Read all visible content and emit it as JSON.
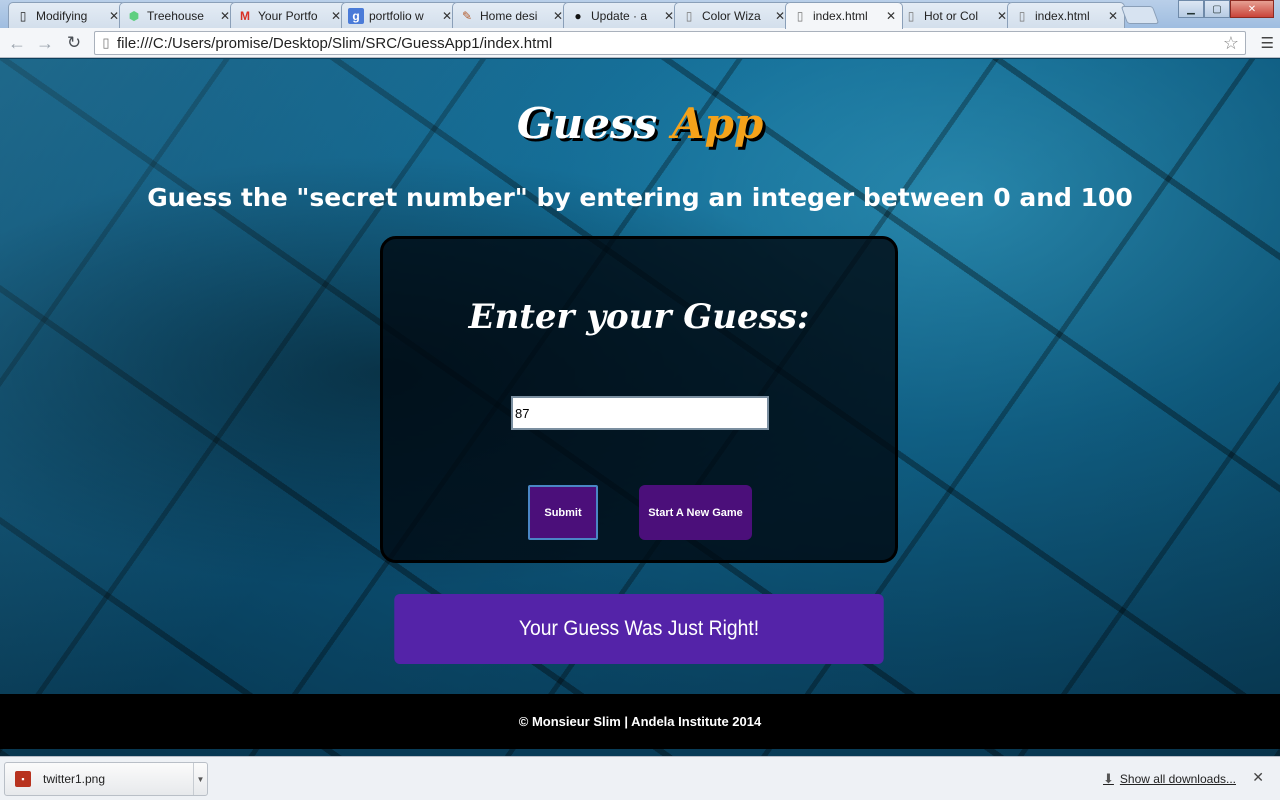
{
  "browser": {
    "tabs": [
      {
        "label": "Modifying",
        "icon": "doc-g-icon",
        "active": false
      },
      {
        "label": "Treehouse",
        "icon": "treehouse-icon",
        "active": false
      },
      {
        "label": "Your Portfo",
        "icon": "gmail-icon",
        "active": false
      },
      {
        "label": "portfolio w",
        "icon": "google-icon",
        "active": false
      },
      {
        "label": "Home desi",
        "icon": "pen-icon",
        "active": false
      },
      {
        "label": "Update · a",
        "icon": "github-icon",
        "active": false
      },
      {
        "label": "Color Wiza",
        "icon": "page-icon",
        "active": false
      },
      {
        "label": "index.html",
        "icon": "page-icon",
        "active": true
      },
      {
        "label": "Hot or Col",
        "icon": "page-icon",
        "active": false
      },
      {
        "label": "index.html",
        "icon": "page-icon",
        "active": false
      }
    ],
    "url": "file:///C:/Users/promise/Desktop/Slim/SRC/GuessApp1/index.html"
  },
  "app": {
    "title_main": "Guess",
    "title_accent": "App",
    "instructions": "Guess the \"secret number\" by entering an integer between 0 and 100",
    "panel_heading": "Enter your Guess:",
    "guess_value": "87",
    "submit_label": "Submit",
    "new_game_label": "Start A New Game",
    "result": "Your Guess Was Just Right!",
    "footer": "© Monsieur Slim | Andela Institute 2014",
    "colors": {
      "accent": "#f5a21a",
      "button": "#4b0f7a",
      "banner": "#5423a8"
    }
  },
  "downloads": {
    "file_name": "twitter1.png",
    "show_all": "Show all downloads..."
  }
}
